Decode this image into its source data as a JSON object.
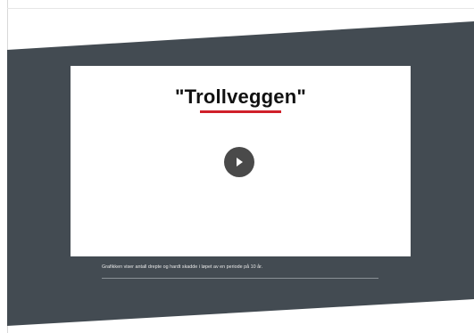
{
  "video": {
    "title": "\"Trollveggen\"",
    "play_label": "Play"
  },
  "caption": {
    "text": "Grafikken viser antall drepte og hardt skadde i løpet av en periode på 10 år."
  },
  "colors": {
    "band": "#434b52",
    "card": "#ffffff",
    "accent_underline": "#d0202a",
    "play_button": "#4a4a4a"
  },
  "icons": {
    "play": "play-icon"
  }
}
